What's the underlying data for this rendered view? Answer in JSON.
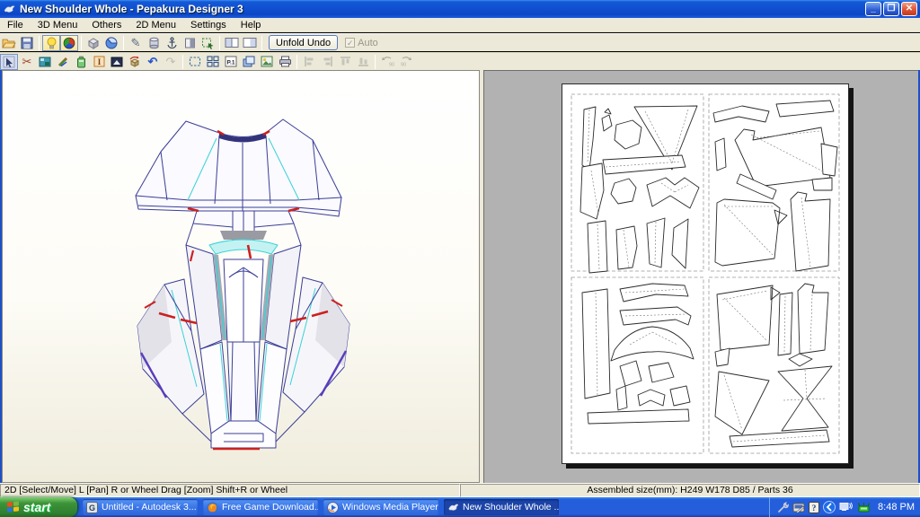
{
  "window": {
    "title": "New Shoulder Whole - Pepakura Designer 3",
    "controls": {
      "minimize": "_",
      "restore": "❐",
      "close": "✕"
    }
  },
  "menu_bar": {
    "items": [
      "File",
      "3D Menu",
      "Others",
      "2D Menu",
      "Settings",
      "Help"
    ]
  },
  "toolbar_main": {
    "icons": [
      "open-file",
      "save-file",
      "light-toggle",
      "texture-view",
      "solid-view",
      "section-view",
      "pen-tool",
      "cylinder-tool",
      "anchor-tool",
      "panel-view",
      "select-area",
      "layout-both-panes",
      "layout-2d-pane"
    ],
    "unfold_undo_label": "Unfold Undo",
    "auto_label": "Auto",
    "auto_checked": "✓"
  },
  "toolbar_2d": {
    "icons": [
      "select-arrow",
      "cut-edges",
      "texture-image",
      "color-pens",
      "battery",
      "insert-text",
      "material",
      "rotate-part",
      "undo",
      "redo",
      "zoom-area",
      "arrange-parts",
      "page-number",
      "layers",
      "export-image",
      "print",
      "align-left",
      "align-right",
      "align-top",
      "align-bottom",
      "rotate-ccw-90",
      "rotate-cw-90"
    ],
    "page_number_label": "P.1",
    "rotate_label": "90"
  },
  "status_bar": {
    "hint": "2D [Select/Move] L [Pan] R or Wheel Drag [Zoom] Shift+R or Wheel",
    "assembled_info": "Assembled size(mm): H249 W178 D85 / Parts 36"
  },
  "taskbar": {
    "start_label": "start",
    "items": [
      {
        "label": "Untitled - Autodesk 3...",
        "icon": "autodesk",
        "active": false
      },
      {
        "label": "Free Game Download...",
        "icon": "firefox",
        "active": false
      },
      {
        "label": "Windows Media Player",
        "icon": "wmp",
        "active": false
      },
      {
        "label": "New Shoulder Whole ...",
        "icon": "pepakura",
        "active": true
      }
    ],
    "tray": {
      "icons": [
        "tool",
        "input-settings",
        "help",
        "collapse-arrow",
        "monitor-audio",
        "network-status"
      ],
      "time": "8:48 PM"
    }
  },
  "colors": {
    "titlebar_blue": "#1050d2",
    "taskbar_blue": "#245edb",
    "start_green": "#3c9338",
    "edge_navy": "#3b3e96",
    "edge_cyan": "#2fd2d6",
    "edge_red": "#cc2020",
    "toolbar_beige": "#ece9d8",
    "pane_gray": "#b2b2b2"
  }
}
